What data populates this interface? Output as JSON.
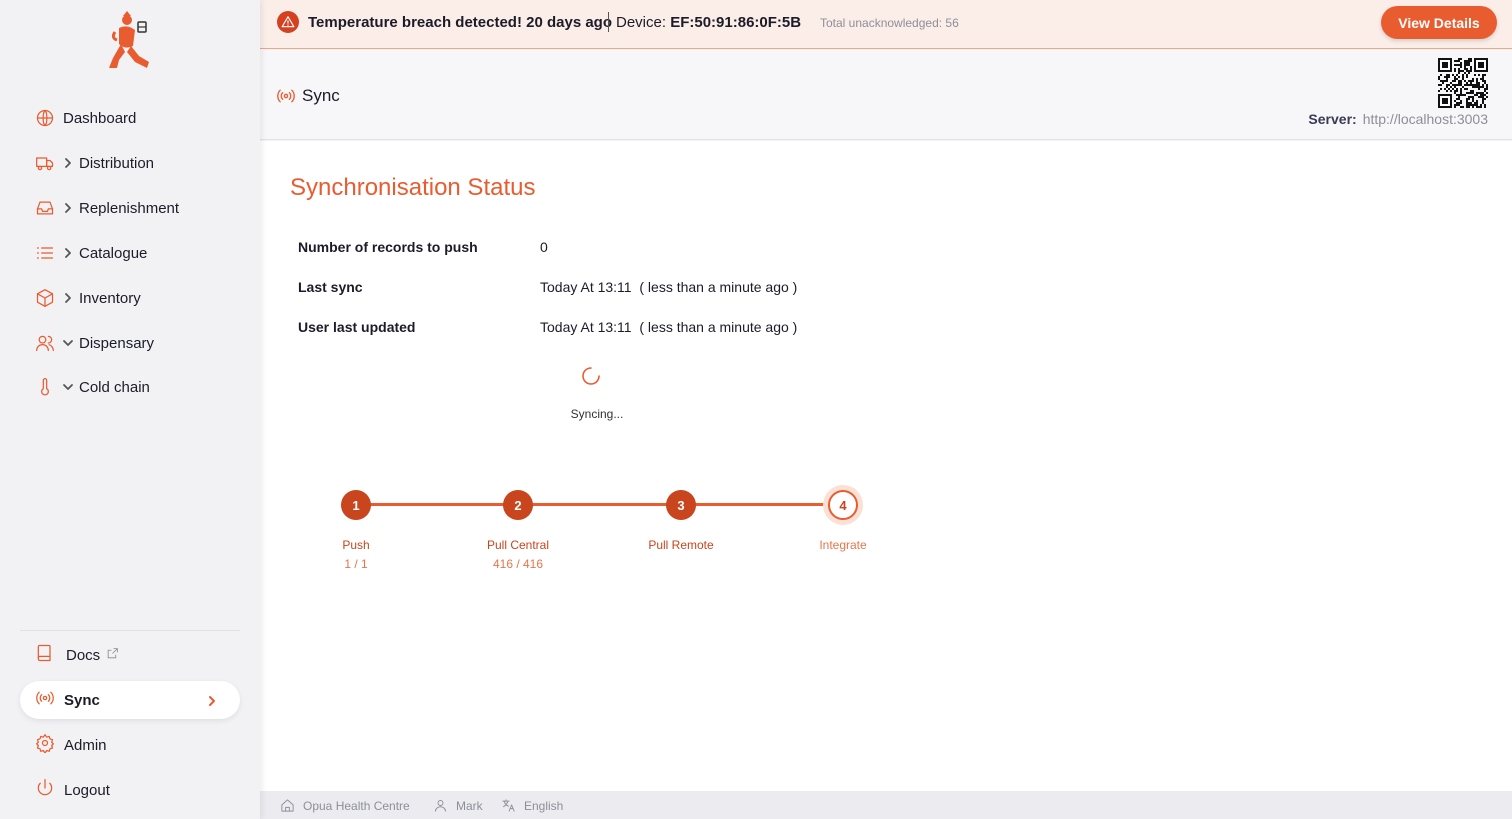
{
  "colors": {
    "accent": "#e95c30",
    "accent_dark": "#c8451e",
    "alert_bg": "#fbeee9"
  },
  "alert": {
    "title": "Temperature breach detected! 20 days ago",
    "device_label": "Device:",
    "device_id": "EF:50:91:86:0F:5B",
    "total": "Total unacknowledged: 56",
    "button": "View Details"
  },
  "sidebar": {
    "items": [
      {
        "label": "Dashboard",
        "icon": "globe-icon",
        "chevron": "none"
      },
      {
        "label": "Distribution",
        "icon": "truck-icon",
        "chevron": "right"
      },
      {
        "label": "Replenishment",
        "icon": "inbox-icon",
        "chevron": "right"
      },
      {
        "label": "Catalogue",
        "icon": "list-icon",
        "chevron": "right"
      },
      {
        "label": "Inventory",
        "icon": "box-icon",
        "chevron": "right"
      },
      {
        "label": "Dispensary",
        "icon": "users-icon",
        "chevron": "down"
      },
      {
        "label": "Cold chain",
        "icon": "thermometer-icon",
        "chevron": "down"
      }
    ],
    "bottom": [
      {
        "label": "Docs",
        "icon": "book-icon"
      },
      {
        "label": "Sync",
        "icon": "radio-icon",
        "active": true
      },
      {
        "label": "Admin",
        "icon": "gear-icon"
      },
      {
        "label": "Logout",
        "icon": "power-icon"
      }
    ]
  },
  "header": {
    "title": "Sync",
    "server_label": "Server:",
    "server_url": "http://localhost:3003"
  },
  "main": {
    "title": "Synchronisation Status",
    "rows": [
      {
        "key": "Number of records to push",
        "value": "0"
      },
      {
        "key": "Last sync",
        "value": "Today At 13:11  ( less than a minute ago )"
      },
      {
        "key": "User last updated",
        "value": "Today At 13:11  ( less than a minute ago )"
      }
    ],
    "status": "Syncing...",
    "steps": [
      {
        "number": "1",
        "label": "Push",
        "progress": "1 / 1",
        "state": "done"
      },
      {
        "number": "2",
        "label": "Pull Central",
        "progress": "416 / 416",
        "state": "done"
      },
      {
        "number": "3",
        "label": "Pull Remote",
        "progress": "",
        "state": "done"
      },
      {
        "number": "4",
        "label": "Integrate",
        "progress": "",
        "state": "current"
      }
    ]
  },
  "footer": {
    "store": "Opua Health Centre",
    "user": "Mark",
    "language": "English"
  }
}
